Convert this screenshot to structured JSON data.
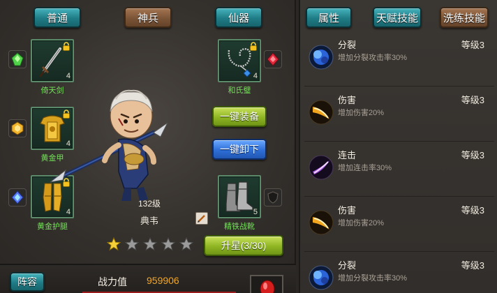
{
  "left_tabs": [
    {
      "label": "普通",
      "active": false
    },
    {
      "label": "神兵",
      "active": true
    },
    {
      "label": "仙器",
      "active": false
    }
  ],
  "right_tabs": [
    {
      "label": "属性",
      "active": false
    },
    {
      "label": "天赋技能",
      "active": false
    },
    {
      "label": "洗练技能",
      "active": true
    }
  ],
  "equipment": {
    "weapon": {
      "name": "倚天剑",
      "level": "4"
    },
    "armor": {
      "name": "黄金甲",
      "level": "4"
    },
    "legs": {
      "name": "黄金护腿",
      "level": "4"
    },
    "necklace": {
      "name": "和氏璧",
      "level": "4"
    },
    "boots": {
      "name": "精铁战靴",
      "level": "5"
    }
  },
  "hero": {
    "level_text": "132级",
    "name": "典韦",
    "stars_filled": 1,
    "stars_total": 5
  },
  "buttons": {
    "equip_all": "一键装备",
    "unequip_all": "一键卸下",
    "upgrade_star": "升星(3/30)"
  },
  "bottom": {
    "lineup_label": "阵容",
    "power_label": "战力值",
    "power_value": "959906"
  },
  "skills": [
    {
      "name": "分裂",
      "level": "等级3",
      "desc": "增加分裂攻击率30%",
      "icon": "blue-orb-icon"
    },
    {
      "name": "伤害",
      "level": "等级3",
      "desc": "增加伤害20%",
      "icon": "golden-slash-icon"
    },
    {
      "name": "连击",
      "level": "等级3",
      "desc": "增加连击率30%",
      "icon": "purple-slash-icon"
    },
    {
      "name": "伤害",
      "level": "等级3",
      "desc": "增加伤害20%",
      "icon": "golden-slash-icon"
    },
    {
      "name": "分裂",
      "level": "等级3",
      "desc": "增加分裂攻击率30%",
      "icon": "blue-orb-icon"
    }
  ],
  "colors": {
    "item_name": "#74e05a",
    "power_value": "#f2a623",
    "teal_tab": "#1f7c86",
    "brown_tab": "#7b5436"
  }
}
